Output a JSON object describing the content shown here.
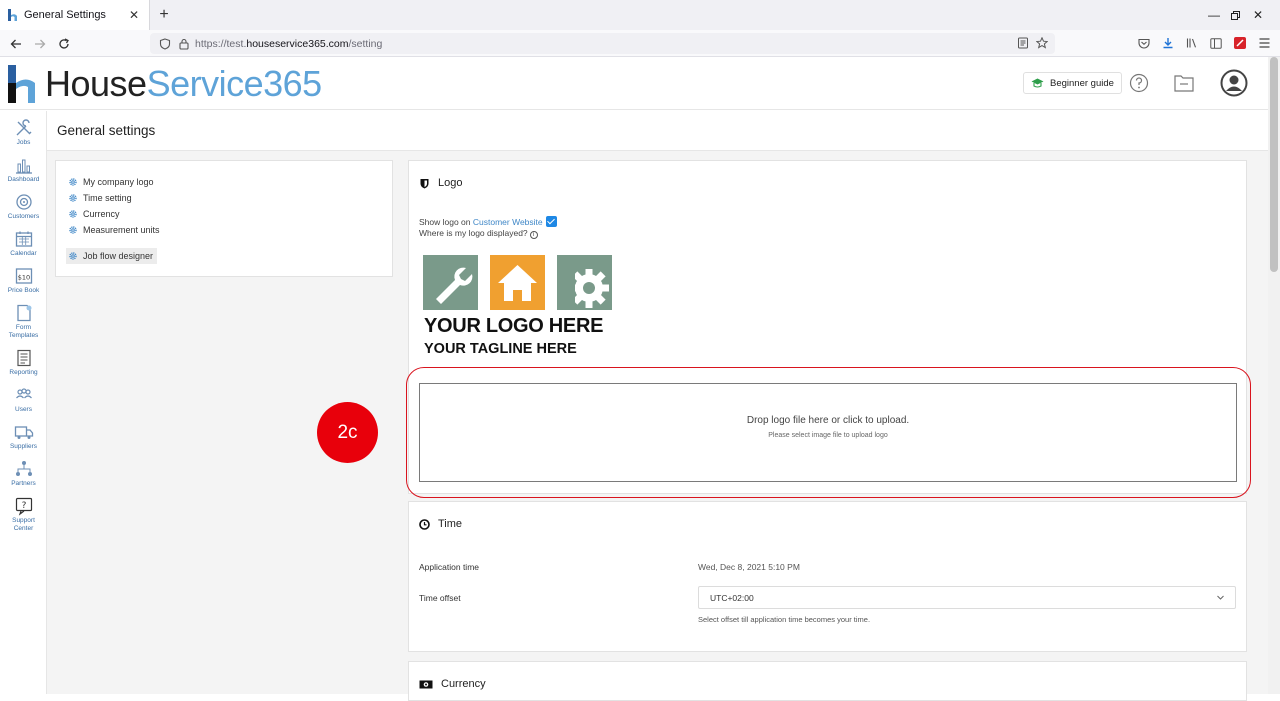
{
  "browser": {
    "tab_title": "General Settings",
    "url_prefix": "https://test.",
    "url_domain": "houseservice365.com",
    "url_path": "/setting"
  },
  "header": {
    "logo_part1": "House",
    "logo_part2": "Service365",
    "beginner_guide": "Beginner guide"
  },
  "sidebar": {
    "items": [
      {
        "label": "Jobs"
      },
      {
        "label": "Dashboard"
      },
      {
        "label": "Customers"
      },
      {
        "label": "Calendar"
      },
      {
        "label": "Price Book"
      },
      {
        "label": "Form"
      },
      {
        "label": "Templates"
      },
      {
        "label": "Reporting"
      },
      {
        "label": "Users"
      },
      {
        "label": "Suppliers"
      },
      {
        "label": "Partners"
      },
      {
        "label": "Support"
      },
      {
        "label": "Center"
      }
    ]
  },
  "page": {
    "title": "General settings"
  },
  "settings_menu": {
    "items": [
      {
        "label": "My company logo"
      },
      {
        "label": "Time setting"
      },
      {
        "label": "Currency"
      },
      {
        "label": "Measurement units"
      },
      {
        "label": "Job flow designer"
      }
    ]
  },
  "logo_section": {
    "title": "Logo",
    "show_logo_prefix": "Show logo on ",
    "show_logo_link": "Customer Website",
    "show_logo_checked": true,
    "where_displayed": "Where is my logo displayed?",
    "sample_line1": "YOUR LOGO HERE",
    "sample_line2": "YOUR TAGLINE HERE",
    "dropzone_main": "Drop logo file here or click to upload.",
    "dropzone_sub": "Please select image file to upload logo"
  },
  "time_section": {
    "title": "Time",
    "application_time_label": "Application time",
    "application_time_value": "Wed, Dec 8, 2021 5:10 PM",
    "time_offset_label": "Time offset",
    "time_offset_value": "UTC+02:00",
    "time_offset_hint": "Select offset till application time becomes your time."
  },
  "currency_section": {
    "title": "Currency"
  },
  "annotation": {
    "label": "2c"
  },
  "colors": {
    "brand_blue": "#5ea3d8",
    "link": "#3f87c7",
    "annotation_red": "#e8000b",
    "logo_green": "#7a9a8a",
    "logo_orange": "#f0a030"
  }
}
